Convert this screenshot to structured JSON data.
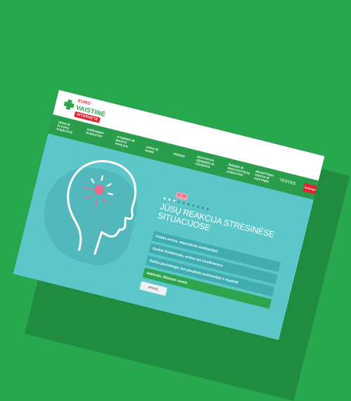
{
  "header": {
    "logo_top": "EURO",
    "logo_brand": "VAISTINĖ",
    "logo_sub": "INTERNETE"
  },
  "nav": {
    "items": [
      "Odos ir plaukų sveikatos",
      "Virškinimo sveikatos",
      "Vitaminai ir maisto papildai",
      "Vaikų ir mamų",
      "Higiena",
      "Nuotaikos gerinimo ir sąveikos",
      "Širdies ir kraujagyslių sveikatos",
      "Receptiniai vaistai ir vaistinės"
    ],
    "user": "TESTAS",
    "logout": "Atsijungti"
  },
  "quiz": {
    "progress_badge": "3 / 10",
    "total_steps": 10,
    "current_step": 3,
    "question": "Jūsų reakcija stresinėse situacijose",
    "options": [
      {
        "label": "Viskas erzina, nepavyksta susitvardyti",
        "selected": false
      },
      {
        "label": "Greitai išsiderinate, erzina net smulkmenos",
        "selected": false
      },
      {
        "label": "Reikia pasistengti, bet pavyksta susitvardyti ir mąstinti",
        "selected": false
      },
      {
        "label": "Adekvati, išliekate ramūs",
        "selected": true
      }
    ],
    "back_label": "ATGAL"
  },
  "colors": {
    "background": "#27a84f",
    "teal": "#5cc6c9",
    "nav_green": "#2a9d4d",
    "accent_red": "#e3232d"
  }
}
